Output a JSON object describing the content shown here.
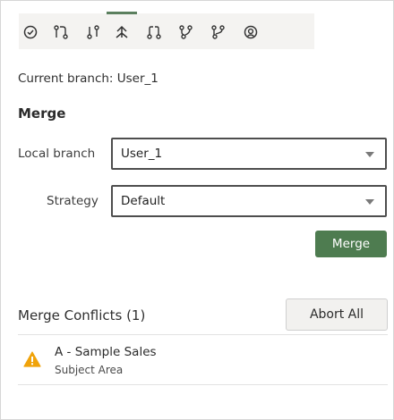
{
  "toolbar": {
    "icons": [
      {
        "name": "check-circle-icon",
        "glyph": "⊘"
      },
      {
        "name": "git-compare-icon",
        "glyph": "⇅"
      },
      {
        "name": "git-pull-icon",
        "glyph": "⇣"
      },
      {
        "name": "merge-icon",
        "glyph": "⤒"
      },
      {
        "name": "git-pull-request-icon",
        "glyph": "⇄"
      },
      {
        "name": "git-branch-icon",
        "glyph": "⑂"
      },
      {
        "name": "git-fork-icon",
        "glyph": "⑃"
      },
      {
        "name": "user-circle-icon",
        "glyph": "◎"
      }
    ],
    "active_index": 3,
    "accent_color": "#5b7f5e"
  },
  "current_branch_text": "Current branch: User_1",
  "merge_section": {
    "title": "Merge",
    "local_branch_label": "Local branch",
    "local_branch_value": "User_1",
    "strategy_label": "Strategy",
    "strategy_value": "Default",
    "merge_button_label": "Merge",
    "merge_button_color": "#4e7c50"
  },
  "conflicts": {
    "title": "Merge Conflicts (1)",
    "abort_button_label": "Abort All",
    "items": [
      {
        "title": "A - Sample Sales",
        "subtitle": "Subject Area",
        "icon": "warning-icon",
        "icon_color": "#f0a30a"
      }
    ]
  }
}
